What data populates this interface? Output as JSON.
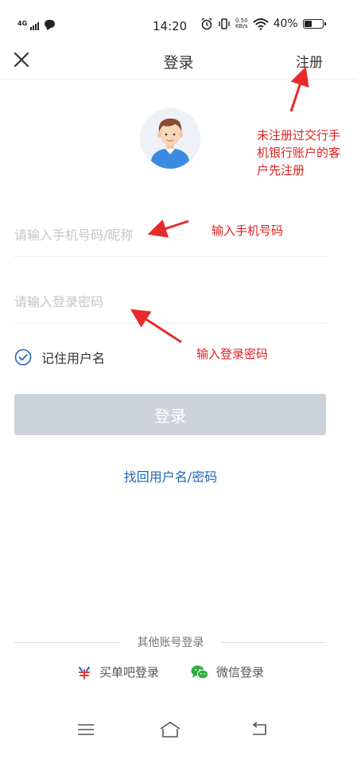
{
  "status_bar": {
    "network": "4G",
    "time": "14:20",
    "speed_value": "0.50",
    "speed_unit": "KB/s",
    "battery_percent": "40%",
    "battery_level": 0.4
  },
  "header": {
    "title": "登录",
    "register_label": "注册"
  },
  "form": {
    "username_placeholder": "请输入手机号码/昵称",
    "password_placeholder": "请输入登录密码",
    "remember_label": "记住用户名",
    "remember_checked": true,
    "login_button": "登录",
    "forgot_link": "找回用户名/密码"
  },
  "other_login": {
    "title": "其他账号登录",
    "maidanba_label": "买单吧登录",
    "wechat_label": "微信登录"
  },
  "annotations": {
    "register_note_line1": "未注册过交行手",
    "register_note_line2": "机银行账户的客",
    "register_note_line3": "户先注册",
    "phone_note": "输入手机号码",
    "password_note": "输入登录密码"
  },
  "colors": {
    "accent": "#1f66b5",
    "annotation": "#e02020",
    "button_disabled": "#cdd2d9",
    "wechat": "#2aae3f"
  }
}
